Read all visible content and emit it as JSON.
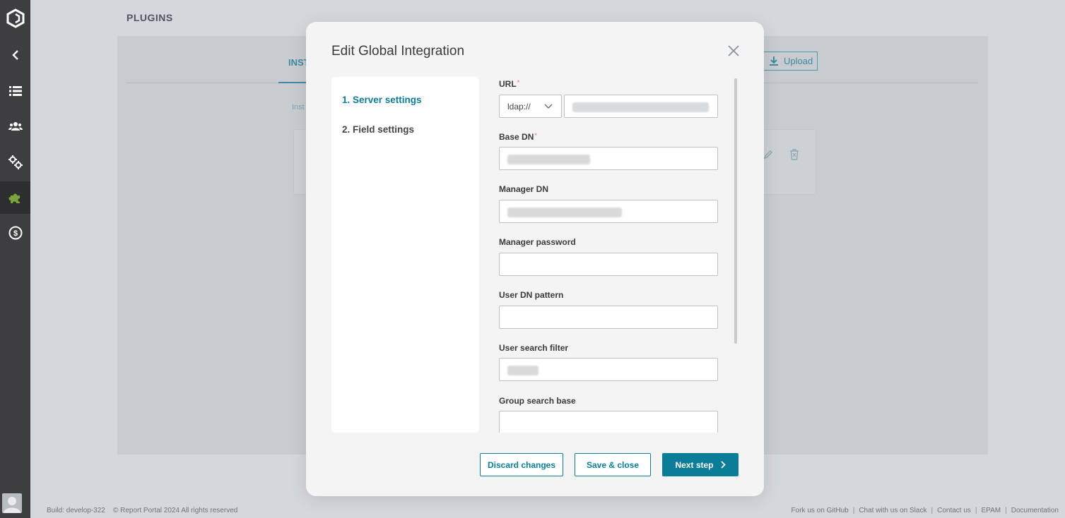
{
  "page": {
    "title": "PLUGINS",
    "tab_label": "INST",
    "sub_text": "Inst",
    "upload_label": "Upload"
  },
  "sidebar": {
    "items": [
      "logo-icon",
      "back-icon",
      "launches-icon",
      "members-icon",
      "settings-icon",
      "plugins-icon",
      "billing-icon"
    ]
  },
  "modal": {
    "title": "Edit Global Integration",
    "steps": [
      {
        "label": "1. Server settings",
        "active": true
      },
      {
        "label": "2. Field settings",
        "active": false
      }
    ],
    "fields": {
      "url": {
        "label": "URL",
        "protocol": "ldap://"
      },
      "base_dn": {
        "label": "Base DN"
      },
      "manager_dn": {
        "label": "Manager DN"
      },
      "manager_password": {
        "label": "Manager password"
      },
      "user_dn_pattern": {
        "label": "User DN pattern"
      },
      "user_search_filter": {
        "label": "User search filter"
      },
      "group_search_base": {
        "label": "Group search base"
      }
    },
    "required_mark": "*",
    "buttons": {
      "discard": "Discard changes",
      "save_close": "Save & close",
      "next": "Next step"
    }
  },
  "footer": {
    "build": "Build: develop-322",
    "copyright": "© Report Portal 2024 All rights reserved",
    "links": [
      "Fork us on GitHub",
      "Chat with us on Slack",
      "Contact us",
      "EPAM",
      "Documentation"
    ]
  },
  "colors": {
    "accent": "#0c7d98",
    "sidebar": "#3e3e40",
    "plugins_active": "#7ba33a"
  }
}
